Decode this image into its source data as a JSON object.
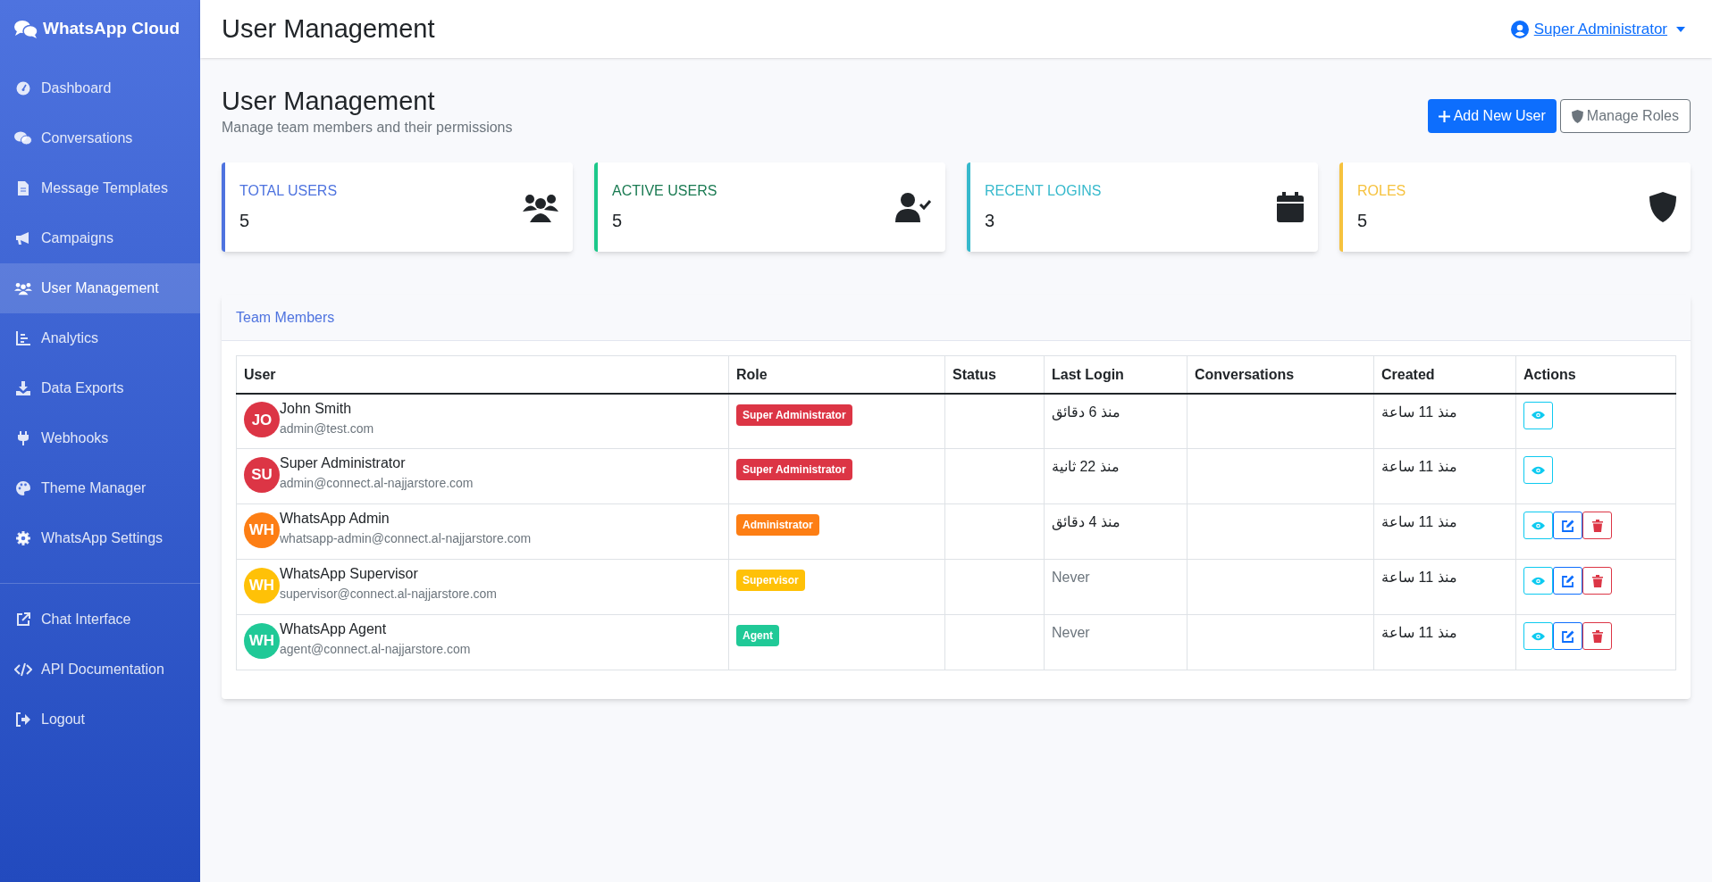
{
  "sidebar": {
    "brand": "WhatsApp Cloud",
    "items": [
      {
        "label": "Dashboard",
        "selected": false
      },
      {
        "label": "Conversations",
        "selected": false
      },
      {
        "label": "Message Templates",
        "selected": false
      },
      {
        "label": "Campaigns",
        "selected": false
      },
      {
        "label": "User Management",
        "selected": true
      },
      {
        "label": "Analytics",
        "selected": false
      },
      {
        "label": "Data Exports",
        "selected": false
      },
      {
        "label": "Webhooks",
        "selected": false
      },
      {
        "label": "Theme Manager",
        "selected": false
      },
      {
        "label": "WhatsApp Settings",
        "selected": false
      }
    ],
    "footer_items": [
      {
        "label": "Chat Interface"
      },
      {
        "label": "API Documentation"
      },
      {
        "label": "Logout"
      }
    ]
  },
  "topbar": {
    "title": "User Management",
    "user": "Super Administrator"
  },
  "header": {
    "title": "User Management",
    "subtitle": "Manage team members and their permissions",
    "buttons": [
      {
        "label": "Add New User",
        "kind": "primary"
      },
      {
        "label": "Manage Roles",
        "kind": "secondary"
      }
    ]
  },
  "stats": [
    {
      "label": "TOTAL USERS",
      "value": "5",
      "color": "#4e73df"
    },
    {
      "label": "ACTIVE USERS",
      "value": "5",
      "color": "#1cc88a"
    },
    {
      "label": "RECENT LOGINS",
      "value": "3",
      "color": "#36b9cc"
    },
    {
      "label": "ROLES",
      "value": "5",
      "color": "#f6c23e"
    }
  ],
  "table": {
    "title": "Team Members",
    "columns": [
      "User",
      "Role",
      "Status",
      "Last Login",
      "Conversations",
      "Created",
      "Actions"
    ],
    "rows": [
      {
        "avatar": {
          "initials": "JO",
          "color": "#dc3545"
        },
        "name": "John Smith",
        "email": "admin@test.com",
        "role": {
          "label": "Super Administrator",
          "color": "#dc3545"
        },
        "last_login": "منذ 6 دقائق",
        "never": false,
        "created": "منذ 11 ساعة",
        "actions": [
          {
            "kind": "view"
          }
        ]
      },
      {
        "avatar": {
          "initials": "SU",
          "color": "#dc3545"
        },
        "name": "Super Administrator",
        "email": "admin@connect.al-najjarstore.com",
        "role": {
          "label": "Super Administrator",
          "color": "#dc3545"
        },
        "last_login": "منذ 22 ثانية",
        "never": false,
        "created": "منذ 11 ساعة",
        "actions": [
          {
            "kind": "view"
          }
        ]
      },
      {
        "avatar": {
          "initials": "WH",
          "color": "#fd7e14"
        },
        "name": "WhatsApp Admin",
        "email": "whatsapp-admin@connect.al-najjarstore.com",
        "role": {
          "label": "Administrator",
          "color": "#fd7e14"
        },
        "last_login": "منذ 4 دقائق",
        "never": false,
        "created": "منذ 11 ساعة",
        "actions": [
          {
            "kind": "view"
          },
          {
            "kind": "edit"
          },
          {
            "kind": "delete"
          }
        ]
      },
      {
        "avatar": {
          "initials": "WH",
          "color": "#ffc107"
        },
        "name": "WhatsApp Supervisor",
        "email": "supervisor@connect.al-najjarstore.com",
        "role": {
          "label": "Supervisor",
          "color": "#ffc107"
        },
        "last_login": "Never",
        "never": true,
        "created": "منذ 11 ساعة",
        "actions": [
          {
            "kind": "view"
          },
          {
            "kind": "edit"
          },
          {
            "kind": "delete"
          }
        ]
      },
      {
        "avatar": {
          "initials": "WH",
          "color": "#20c997"
        },
        "name": "WhatsApp Agent",
        "email": "agent@connect.al-najjarstore.com",
        "role": {
          "label": "Agent",
          "color": "#20c997"
        },
        "last_login": "Never",
        "never": true,
        "created": "منذ 11 ساعة",
        "actions": [
          {
            "kind": "view"
          },
          {
            "kind": "edit"
          },
          {
            "kind": "delete"
          }
        ]
      }
    ]
  }
}
